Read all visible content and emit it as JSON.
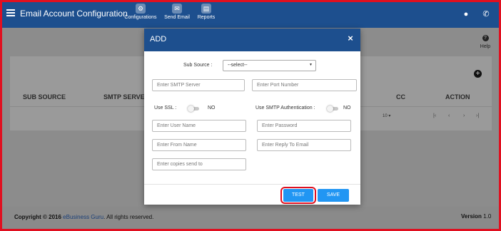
{
  "app": {
    "title": "Email Account Configuration",
    "nav": [
      {
        "label": "Configurations",
        "icon": "gear-icon"
      },
      {
        "label": "Send Email",
        "icon": "envelope-icon"
      },
      {
        "label": "Reports",
        "icon": "report-icon"
      }
    ]
  },
  "background": {
    "help_label": "Help",
    "columns": [
      "SUB SOURCE",
      "SMTP SERVE",
      "CC",
      "ACTION"
    ],
    "pager": {
      "page_size": "10 ▾"
    }
  },
  "footer": {
    "copyright_prefix": "Copyright © 2016",
    "brand": "eBusiness Guru",
    "copyright_suffix": ". All rights reserved.",
    "version_label": "Version",
    "version_value": "1.0"
  },
  "modal": {
    "title": "ADD",
    "sub_source_label": "Sub Source :",
    "sub_source_value": "--select--",
    "fields": {
      "smtp_server": "Enter SMTP Server",
      "port_number": "Enter Port Number",
      "user_name": "Enter User Name",
      "password": "Enter Password",
      "from_name": "Enter From Name",
      "reply_to": "Enter Reply To Email",
      "copies": "Enter copies send to"
    },
    "use_ssl_label": "Use SSL :",
    "use_ssl_value": "NO",
    "smtp_auth_label": "Use SMTP Authentication :",
    "smtp_auth_value": "NO",
    "test_label": "TEST",
    "save_label": "SAVE"
  },
  "colors": {
    "brand_blue": "#1d4f8e",
    "button_blue": "#2196f3",
    "highlight_red": "#e01020"
  }
}
